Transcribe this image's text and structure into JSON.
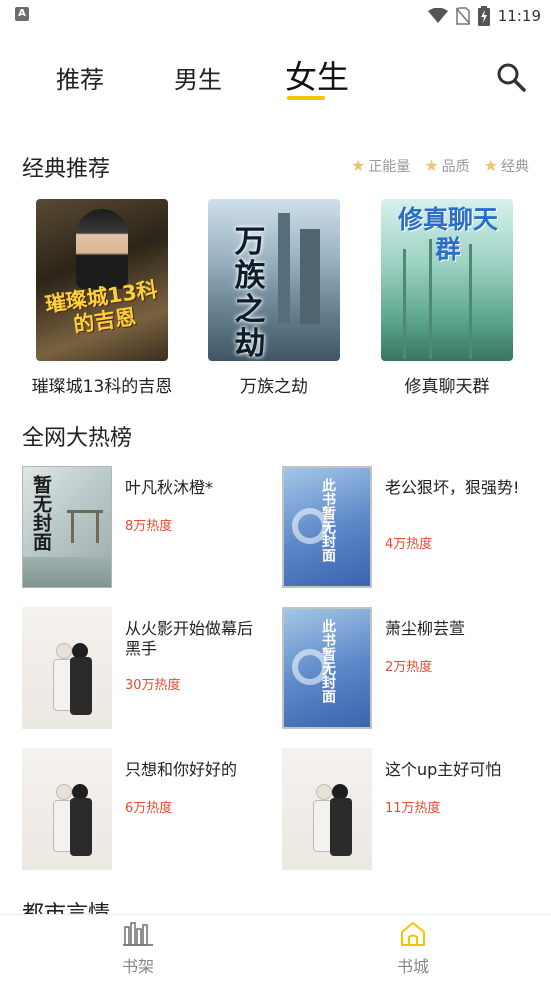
{
  "status_bar": {
    "notification_badge": "A",
    "time": "11:19",
    "icons": [
      "wifi-icon",
      "no-sim-icon",
      "battery-charging-icon"
    ]
  },
  "top_tabs": [
    {
      "label": "推荐",
      "active": false
    },
    {
      "label": "男生",
      "active": false
    },
    {
      "label": "女生",
      "active": true
    }
  ],
  "accent_color": "#f5c400",
  "classic_section": {
    "title": "经典推荐",
    "badges": [
      "正能量",
      "品质",
      "经典"
    ],
    "books": [
      {
        "title": "璀璨城13科的吉恩",
        "cover_text": "璀璨城13科的吉恩"
      },
      {
        "title": "万族之劫",
        "cover_text": "万族之劫"
      },
      {
        "title": "修真聊天群",
        "cover_text": "修真聊天群"
      }
    ]
  },
  "hot_section": {
    "title": "全网大热榜",
    "placeholder_cover_text": "暂无封面",
    "blue_cover_text": "此书暂无封面",
    "items": [
      {
        "name": "叶凡秋沐橙*",
        "heat": "8万热度",
        "cover": "placeholder"
      },
      {
        "name": "老公狠坏，狠强势!",
        "heat": "4万热度",
        "cover": "blue"
      },
      {
        "name": "从火影开始做幕后黑手",
        "heat": "30万热度",
        "cover": "couple"
      },
      {
        "name": "萧尘柳芸萱",
        "heat": "2万热度",
        "cover": "blue"
      },
      {
        "name": "只想和你好好的",
        "heat": "6万热度",
        "cover": "couple"
      },
      {
        "name": "这个up主好可怕",
        "heat": "11万热度",
        "cover": "couple"
      }
    ]
  },
  "next_section": {
    "title": "都市言情"
  },
  "bottom_nav": [
    {
      "label": "书架",
      "icon": "bookshelf-icon",
      "active": false
    },
    {
      "label": "书城",
      "icon": "home-icon",
      "active": true
    }
  ]
}
